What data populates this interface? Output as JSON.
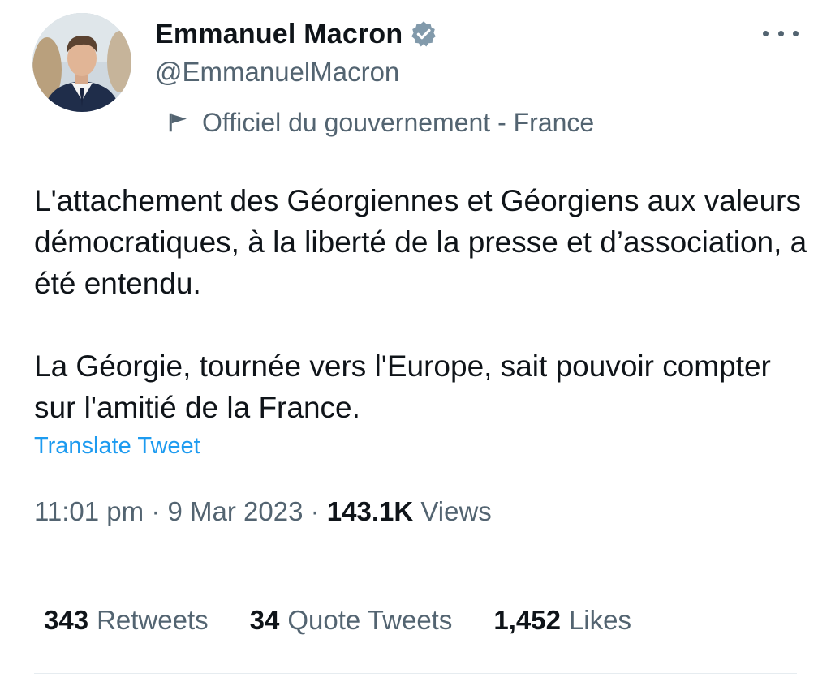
{
  "author": {
    "display_name": "Emmanuel Macron",
    "handle": "@EmmanuelMacron",
    "avatar": "profile-photo",
    "verified_icon": "verified-badge-icon",
    "verified_color": "#829aab"
  },
  "label": {
    "icon": "flag-icon",
    "text": "Officiel du gouvernement - France"
  },
  "more_icon": "more-horizontal-icon",
  "tweet": {
    "paragraphs": [
      "L'attachement des Géorgiennes et Géorgiens aux valeurs démocratiques, à la liberté de la presse et d’association, a été entendu.",
      "La Géorgie, tournée vers l'Europe, sait pouvoir compter sur l'amitié de la France."
    ],
    "translate_label": "Translate Tweet"
  },
  "meta": {
    "time": "11:01 pm",
    "date": "9 Mar 2023",
    "separator": "·",
    "views_count": "143.1K",
    "views_label": "Views"
  },
  "stats": {
    "retweets": {
      "count": "343",
      "label": "Retweets"
    },
    "quote_tweets": {
      "count": "34",
      "label": "Quote Tweets"
    },
    "likes": {
      "count": "1,452",
      "label": "Likes"
    }
  },
  "colors": {
    "text_primary": "#0f1419",
    "text_secondary": "#536471",
    "link": "#1d9bf0",
    "divider": "#e6ecf0"
  }
}
